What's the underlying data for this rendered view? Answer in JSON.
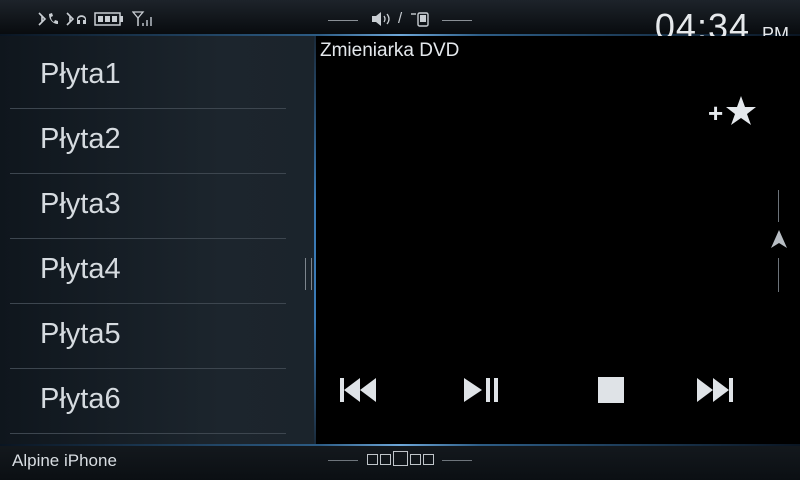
{
  "status": {
    "icons": [
      "bluetooth-phone-icon",
      "bluetooth-audio-icon",
      "battery-icon",
      "signal-icon",
      "volume-icon",
      "phone-icon"
    ],
    "separator": "/",
    "time": "04:34",
    "ampm": "PM"
  },
  "list": {
    "items": [
      {
        "label": "Płyta1"
      },
      {
        "label": "Płyta2"
      },
      {
        "label": "Płyta3"
      },
      {
        "label": "Płyta4"
      },
      {
        "label": "Płyta5"
      },
      {
        "label": "Płyta6"
      }
    ]
  },
  "main": {
    "title": "Zmieniarka DVD",
    "favorite_plus": "+",
    "controls": [
      "previous-icon",
      "play-pause-icon",
      "stop-icon",
      "next-icon"
    ]
  },
  "bottom": {
    "source": "Alpine iPhone",
    "pages": 5,
    "active_page": 3
  },
  "colors": {
    "accent": "#3a7ab5",
    "text": "#d6dbe0"
  }
}
